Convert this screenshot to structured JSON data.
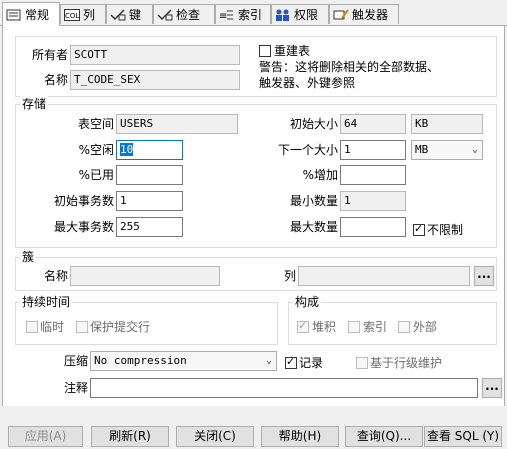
{
  "tabs": [
    {
      "label": "常规",
      "icon": "general-icon"
    },
    {
      "label": "列",
      "icon": "columns-icon"
    },
    {
      "label": "键",
      "icon": "key-icon"
    },
    {
      "label": "检查",
      "icon": "check-icon"
    },
    {
      "label": "索引",
      "icon": "index-icon"
    },
    {
      "label": "权限",
      "icon": "privileges-icon"
    },
    {
      "label": "触发器",
      "icon": "trigger-icon"
    }
  ],
  "header": {
    "owner_label": "所有者",
    "owner_value": "SCOTT",
    "name_label": "名称",
    "name_value": "T_CODE_SEX",
    "rebuild_label": "重建表",
    "rebuild_checked": false,
    "warning_text": "警告：这将删除相关的全部数据、触发器、外键参照",
    "warning_line1": "警告：这将删除相关的全部数据、",
    "warning_line2": "触发器、外键参照"
  },
  "storage": {
    "legend": "存储",
    "tablespace_label": "表空间",
    "tablespace_value": "USERS",
    "pctfree_label": "%空闲",
    "pctfree_value": "10",
    "pctused_label": "%已用",
    "pctused_value": "",
    "initrans_label": "初始事务数",
    "initrans_value": "1",
    "maxtrans_label": "最大事务数",
    "maxtrans_value": "255",
    "initial_label": "初始大小",
    "initial_value": "64",
    "initial_unit": "KB",
    "next_label": "下一个大小",
    "next_value": "1",
    "next_unit": "MB",
    "pctincrease_label": "%增加",
    "pctincrease_value": "",
    "minextents_label": "最小数量",
    "minextents_value": "1",
    "maxextents_label": "最大数量",
    "maxextents_value": "",
    "unlimited_label": "不限制",
    "unlimited_checked": true
  },
  "cluster": {
    "legend": "簇",
    "name_label": "名称",
    "name_value": "",
    "columns_label": "列",
    "columns_value": "",
    "browse_label": "..."
  },
  "duration": {
    "legend": "持续时间",
    "temporary_label": "临时",
    "preserve_label": "保护提交行"
  },
  "organization": {
    "legend": "构成",
    "heap_label": "堆积",
    "index_label": "索引",
    "external_label": "外部"
  },
  "compress": {
    "label": "压缩",
    "value": "No compression",
    "logging_label": "记录",
    "logging_checked": true,
    "rowlevel_label": "基于行级维护"
  },
  "comment": {
    "label": "注释",
    "value": "",
    "browse_label": "..."
  },
  "buttons": {
    "apply": "应用(A)",
    "refresh": "刷新(R)",
    "close": "关闭(C)",
    "help": "帮助(H)",
    "query": "查询(Q)...",
    "view_sql": "查看 SQL (Y)"
  }
}
